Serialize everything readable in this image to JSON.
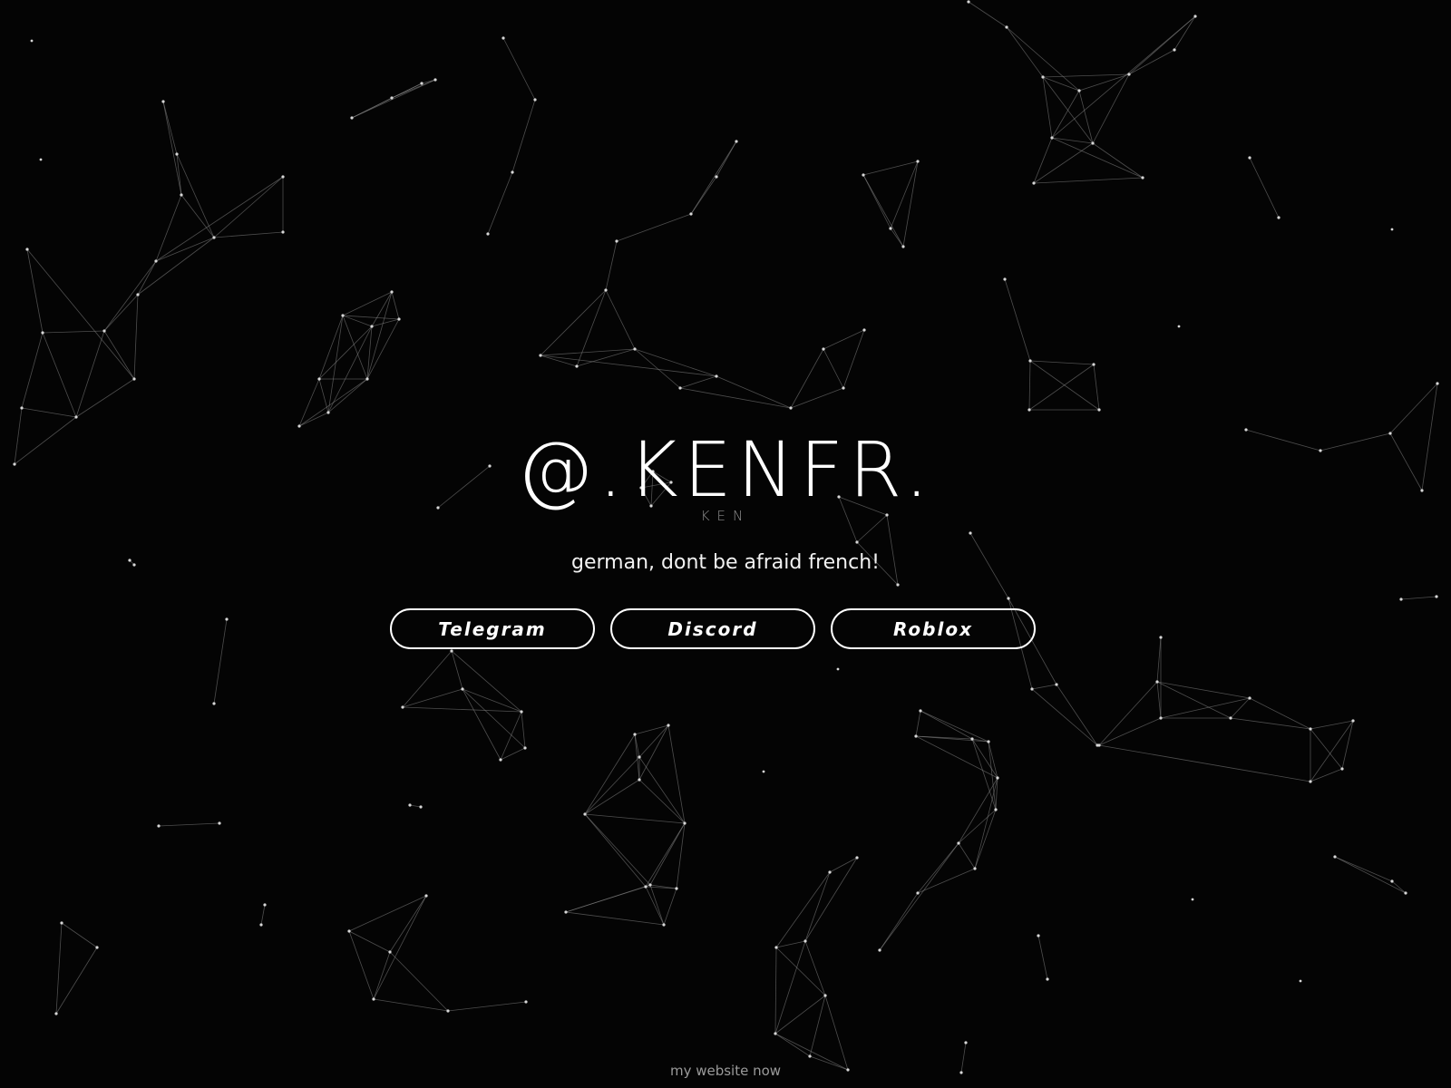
{
  "hero": {
    "handle": "@.KENFR.",
    "subtitle": "KEN",
    "tagline": "german, dont be afraid french!"
  },
  "links": [
    {
      "label": "Telegram"
    },
    {
      "label": "Discord"
    },
    {
      "label": "Roblox"
    }
  ],
  "footer": {
    "text": "my website now"
  },
  "colors": {
    "background": "#040404",
    "foreground": "#ffffff",
    "particle_line": "#8a8a8a"
  }
}
